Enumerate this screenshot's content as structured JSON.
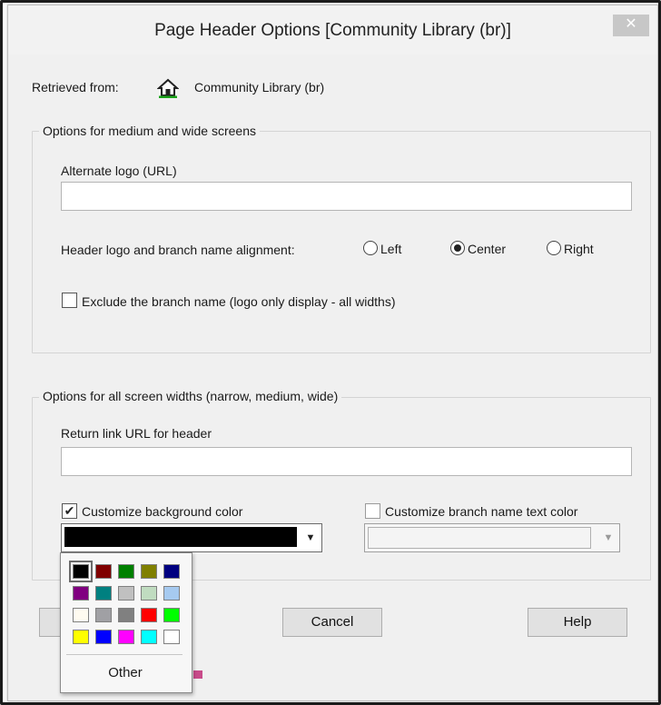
{
  "dialog": {
    "title": "Page Header Options [Community Library  (br)]",
    "close_glyph": "✕"
  },
  "retrieved": {
    "label": "Retrieved from:",
    "icon": "home-icon",
    "value": "Community Library  (br)"
  },
  "group_medium": {
    "legend": "Options for medium and wide screens",
    "alt_logo_label": "Alternate logo (URL)",
    "alt_logo_value": "",
    "alignment_label": "Header logo and branch name alignment:",
    "alignment_options": [
      "Left",
      "Center",
      "Right"
    ],
    "alignment_selected": "Center",
    "exclude_label": "Exclude the branch name (logo only display - all widths)",
    "exclude_checked": false
  },
  "group_all": {
    "legend": "Options for all screen widths (narrow, medium, wide)",
    "return_link_label": "Return link URL for header",
    "return_link_value": "",
    "bg_color_label": "Customize background color",
    "bg_color_checked": true,
    "bg_color_value": "#000000",
    "text_color_label": "Customize branch name text color",
    "text_color_checked": false
  },
  "buttons": {
    "ok": "",
    "cancel": "Cancel",
    "help": "Help"
  },
  "color_palette": {
    "colors": [
      [
        "#000000",
        "#800000",
        "#008000",
        "#808000",
        "#000080"
      ],
      [
        "#800080",
        "#008080",
        "#c0c0c0",
        "#c0dcc0",
        "#a6caf0"
      ],
      [
        "#fffbf0",
        "#a0a0a4",
        "#808080",
        "#ff0000",
        "#00ff00"
      ],
      [
        "#ffff00",
        "#0000ff",
        "#ff00ff",
        "#00ffff",
        "#ffffff"
      ]
    ],
    "selected": "#000000",
    "other_label": "Other"
  }
}
